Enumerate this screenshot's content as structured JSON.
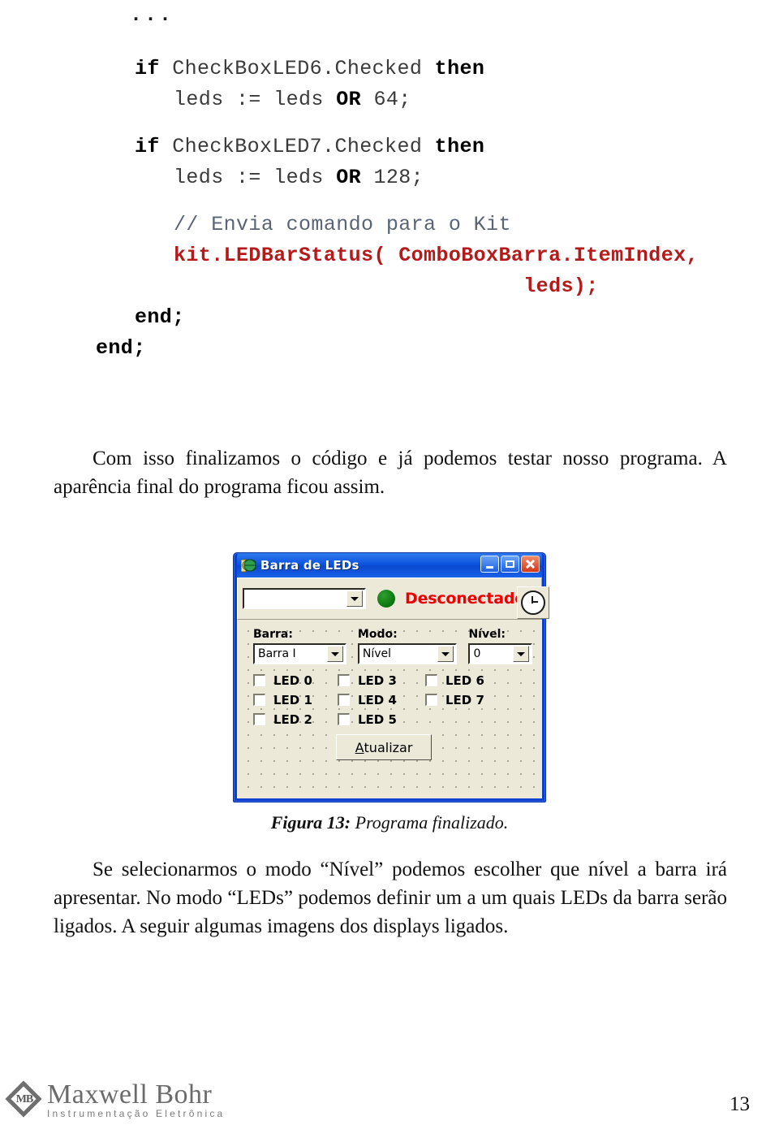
{
  "document": {
    "page_number": "13",
    "code": {
      "top_ellipsis": "...",
      "lines": [
        {
          "id": "l1",
          "indent": 1,
          "segments": [
            {
              "t": "if ",
              "c": "kw"
            },
            {
              "t": "CheckBoxLED6.Checked",
              "c": "id"
            },
            {
              "t": " then",
              "c": "kw"
            }
          ]
        },
        {
          "id": "l2",
          "indent": 2,
          "segments": [
            {
              "t": "leds := leds ",
              "c": "id"
            },
            {
              "t": "OR",
              "c": "kw"
            },
            {
              "t": " 64;",
              "c": "id"
            }
          ]
        },
        {
          "id": "l3",
          "indent": 1,
          "segments": [
            {
              "t": "if ",
              "c": "kw"
            },
            {
              "t": "CheckBoxLED7.Checked",
              "c": "id"
            },
            {
              "t": " then",
              "c": "kw"
            }
          ]
        },
        {
          "id": "l4",
          "indent": 2,
          "segments": [
            {
              "t": "leds := leds ",
              "c": "id"
            },
            {
              "t": "OR",
              "c": "kw"
            },
            {
              "t": " 128;",
              "c": "id"
            }
          ]
        },
        {
          "id": "l5",
          "indent": 2,
          "segments": [
            {
              "t": "// Envia comando para o Kit",
              "c": "cmt"
            }
          ]
        },
        {
          "id": "l6",
          "indent": 2,
          "segments": [
            {
              "t": "kit.LEDBarStatus( ComboBoxBarra.ItemIndex,",
              "c": "call"
            }
          ]
        },
        {
          "id": "l7",
          "indent": 2,
          "segments": [
            {
              "t": "                            leds);",
              "c": "call"
            }
          ]
        },
        {
          "id": "l8",
          "indent": 1,
          "segments": [
            {
              "t": "end;",
              "c": "kw"
            }
          ]
        },
        {
          "id": "l9",
          "indent": 0,
          "segments": [
            {
              "t": "end;",
              "c": "kw"
            }
          ]
        }
      ]
    },
    "paragraph_1": "Com isso finalizamos o código e já podemos testar nosso programa. A aparência final do programa ficou assim.",
    "figure": {
      "caption_label": "Figura 13:",
      "caption_text": " Programa finalizado.",
      "window": {
        "title": "Barra de LEDs",
        "app_icon": "globe-icon",
        "titlebar_color": "#0b52dd",
        "buttons": {
          "minimize": "minimize-icon",
          "maximize": "maximize-icon",
          "close": "close-icon"
        },
        "connection_bar": {
          "port_combo_value": "",
          "indicator_color": "#0f7a12",
          "status_text": "Desconectado",
          "status_color": "#ee0000",
          "timer_button_icon": "clock-icon"
        },
        "fields": [
          {
            "label": "Barra:",
            "value": "Barra I"
          },
          {
            "label": "Modo:",
            "value": "Nível"
          },
          {
            "label": "Nível:",
            "value": "0"
          }
        ],
        "leds": {
          "column_1": [
            "LED 0",
            "LED 1",
            "LED 2"
          ],
          "column_2": [
            "LED 3",
            "LED 4",
            "LED 5"
          ],
          "column_3": [
            "LED 6",
            "LED 7"
          ]
        },
        "update_button": {
          "accel": "A",
          "rest": "tualizar"
        }
      }
    },
    "paragraph_2": "Se selecionarmos o modo “Nível” podemos escolher que nível a barra irá apresentar. No modo “LEDs” podemos definir um a um quais LEDs da barra serão ligados. A seguir algumas imagens dos displays ligados.",
    "footer": {
      "logo_monogram": "MB",
      "logo_name": "Maxwell Bohr",
      "logo_subtitle": "Instrumentação Eletrônica"
    }
  }
}
